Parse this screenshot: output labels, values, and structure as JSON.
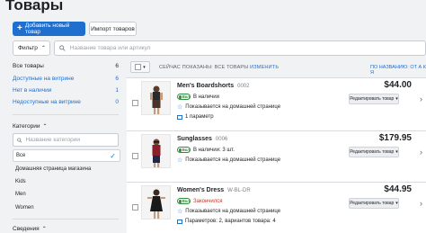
{
  "header": {
    "title": "Товары",
    "add_button": "Добавить новый товар",
    "import_button": "Импорт товаров"
  },
  "filter": {
    "filter_button": "Фильтр",
    "search_placeholder": "Название товара или артикул"
  },
  "sidebar": {
    "counts": [
      {
        "label": "Все товары",
        "count": "6"
      },
      {
        "label": "Доступные на витрине",
        "count": "6"
      },
      {
        "label": "Нет в наличии",
        "count": "1"
      },
      {
        "label": "Недоступные на витрине",
        "count": "0"
      }
    ],
    "categories_title": "Категории",
    "category_search_placeholder": "Название категории",
    "categories": [
      "Все",
      "Домашняя страница магазина",
      "Kids",
      "Men",
      "Women"
    ],
    "bottom_label": "Сведения"
  },
  "list": {
    "shown_prefix": "СЕЙЧАС ПОКАЗАНЫ: ВСЕ ТОВАРЫ",
    "shown_link": "ИЗМЕНИТЬ",
    "sort": "ПО НАЗВАНИЮ: ОТ А К Я"
  },
  "products": [
    {
      "name": "Men's Boardshorts",
      "sku": "0002",
      "toggle": "Вкл",
      "availability": "В наличии",
      "home": "Показывается на домашней странице",
      "params": "1 параметр",
      "price": "$44.00",
      "edit": "Редактировать товар"
    },
    {
      "name": "Sunglasses",
      "sku": "0006",
      "toggle": "Вкл",
      "availability": "В наличии: 3 шт.",
      "home": "Показывается на домашней странице",
      "params": "",
      "price": "$179.95",
      "edit": "Редактировать товар"
    },
    {
      "name": "Women's Dress",
      "sku": "W-BL-DR",
      "toggle": "Вкл",
      "availability": "Закончился",
      "home": "Показывается на домашней странице",
      "params": "Параметров: 2, вариантов товара: 4",
      "price": "$44.95",
      "edit": "Редактировать товар"
    }
  ],
  "colors": {
    "accent": "#1f6fcf",
    "in_stock_toggle": "#2f8f3c",
    "out_of_stock": "#d0311f"
  }
}
